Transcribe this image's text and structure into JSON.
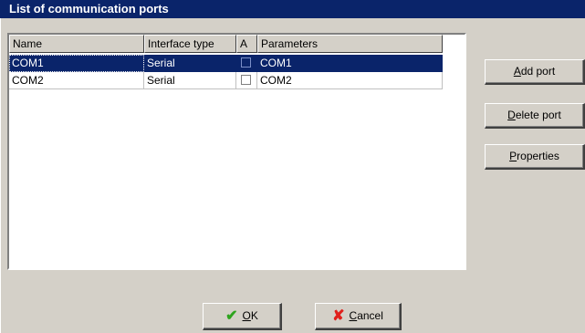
{
  "window": {
    "title": "List of communication ports"
  },
  "table": {
    "columns": [
      "Name",
      "Interface type",
      "A",
      "Parameters"
    ],
    "rows": [
      {
        "name": "COM1",
        "interface_type": "Serial",
        "a_checked": false,
        "parameters": "COM1",
        "selected": true
      },
      {
        "name": "COM2",
        "interface_type": "Serial",
        "a_checked": false,
        "parameters": "COM2",
        "selected": false
      }
    ]
  },
  "buttons": {
    "add_port": {
      "mnemonic": "A",
      "rest": "dd port"
    },
    "delete_port": {
      "mnemonic": "D",
      "rest": "elete port"
    },
    "properties": {
      "mnemonic": "P",
      "rest": "roperties"
    },
    "ok": {
      "mnemonic": "O",
      "rest": "K",
      "icon": "checkmark-icon",
      "icon_color": "#2ea41e"
    },
    "cancel": {
      "mnemonic": "C",
      "rest": "ancel",
      "icon": "x-icon",
      "icon_color": "#e0201c"
    }
  },
  "colors": {
    "titlebar": "#0a246a",
    "selection": "#0a246a",
    "face": "#d4d0c8"
  }
}
